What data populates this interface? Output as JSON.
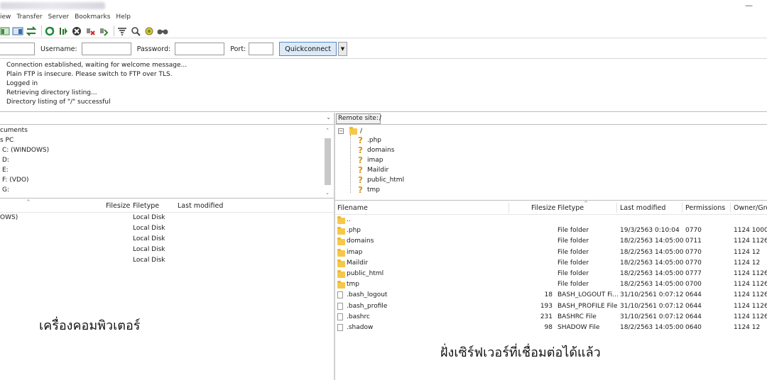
{
  "menu": [
    "iew",
    "Transfer",
    "Server",
    "Bookmarks",
    "Help"
  ],
  "window_controls": "—",
  "quickconnect": {
    "username_label": "Username:",
    "password_label": "Password:",
    "port_label": "Port:",
    "button_label": "Quickconnect",
    "dropdown_glyph": "▼"
  },
  "log": [
    "Connection established, waiting for welcome message...",
    "Plain FTP is insecure. Please switch to FTP over TLS.",
    "Logged in",
    "Retrieving directory listing...",
    "Directory listing of \"/\" successful"
  ],
  "local_tree": [
    "cuments",
    "s PC",
    "C: (WINDOWS)",
    "D:",
    "E:",
    "F: (VDO)",
    "G:"
  ],
  "local_list": {
    "headers": {
      "filesize": "Filesize",
      "filetype": "Filetype",
      "modified": "Last modified"
    },
    "rows": [
      {
        "name": "OWS)",
        "type": "Local Disk"
      },
      {
        "name": "",
        "type": "Local Disk"
      },
      {
        "name": "",
        "type": "Local Disk"
      },
      {
        "name": "",
        "type": "Local Disk"
      },
      {
        "name": "",
        "type": "Local Disk"
      }
    ]
  },
  "remote_site": {
    "label": "Remote site:",
    "path": "/"
  },
  "remote_tree": {
    "root": "/",
    "children": [
      ".php",
      "domains",
      "imap",
      "Maildir",
      "public_html",
      "tmp"
    ]
  },
  "remote_list": {
    "headers": {
      "filename": "Filename",
      "filesize": "Filesize",
      "filetype": "Filetype",
      "modified": "Last modified",
      "permissions": "Permissions",
      "owner": "Owner/Gro"
    },
    "rows": [
      {
        "name": "..",
        "size": "",
        "type": "",
        "modified": "",
        "perm": "",
        "owner": "",
        "icon": "folder"
      },
      {
        "name": ".php",
        "size": "",
        "type": "File folder",
        "modified": "19/3/2563 0:10:04",
        "perm": "0770",
        "owner": "1124 1000",
        "icon": "folder"
      },
      {
        "name": "domains",
        "size": "",
        "type": "File folder",
        "modified": "18/2/2563 14:05:00",
        "perm": "0711",
        "owner": "1124 1126",
        "icon": "folder"
      },
      {
        "name": "imap",
        "size": "",
        "type": "File folder",
        "modified": "18/2/2563 14:05:00",
        "perm": "0770",
        "owner": "1124 12",
        "icon": "folder"
      },
      {
        "name": "Maildir",
        "size": "",
        "type": "File folder",
        "modified": "18/2/2563 14:05:00",
        "perm": "0770",
        "owner": "1124 12",
        "icon": "folder"
      },
      {
        "name": "public_html",
        "size": "",
        "type": "File folder",
        "modified": "18/2/2563 14:05:00",
        "perm": "0777",
        "owner": "1124 1126",
        "icon": "folder-link"
      },
      {
        "name": "tmp",
        "size": "",
        "type": "File folder",
        "modified": "18/2/2563 14:05:00",
        "perm": "0700",
        "owner": "1124 1126",
        "icon": "folder"
      },
      {
        "name": ".bash_logout",
        "size": "18",
        "type": "BASH_LOGOUT Fi...",
        "modified": "31/10/2561 0:07:12",
        "perm": "0644",
        "owner": "1124 1126",
        "icon": "file"
      },
      {
        "name": ".bash_profile",
        "size": "193",
        "type": "BASH_PROFILE File",
        "modified": "31/10/2561 0:07:12",
        "perm": "0644",
        "owner": "1124 1126",
        "icon": "file"
      },
      {
        "name": ".bashrc",
        "size": "231",
        "type": "BASHRC File",
        "modified": "31/10/2561 0:07:12",
        "perm": "0644",
        "owner": "1124 1126",
        "icon": "file"
      },
      {
        "name": ".shadow",
        "size": "98",
        "type": "SHADOW File",
        "modified": "18/2/2563 14:05:00",
        "perm": "0640",
        "owner": "1124 12",
        "icon": "file"
      }
    ]
  },
  "captions": {
    "local": "เครื่องคอมพิวเตอร์",
    "remote": "ฝั่งเซิร์ฟเวอร์ที่เชื่อมต่อได้แล้ว"
  }
}
